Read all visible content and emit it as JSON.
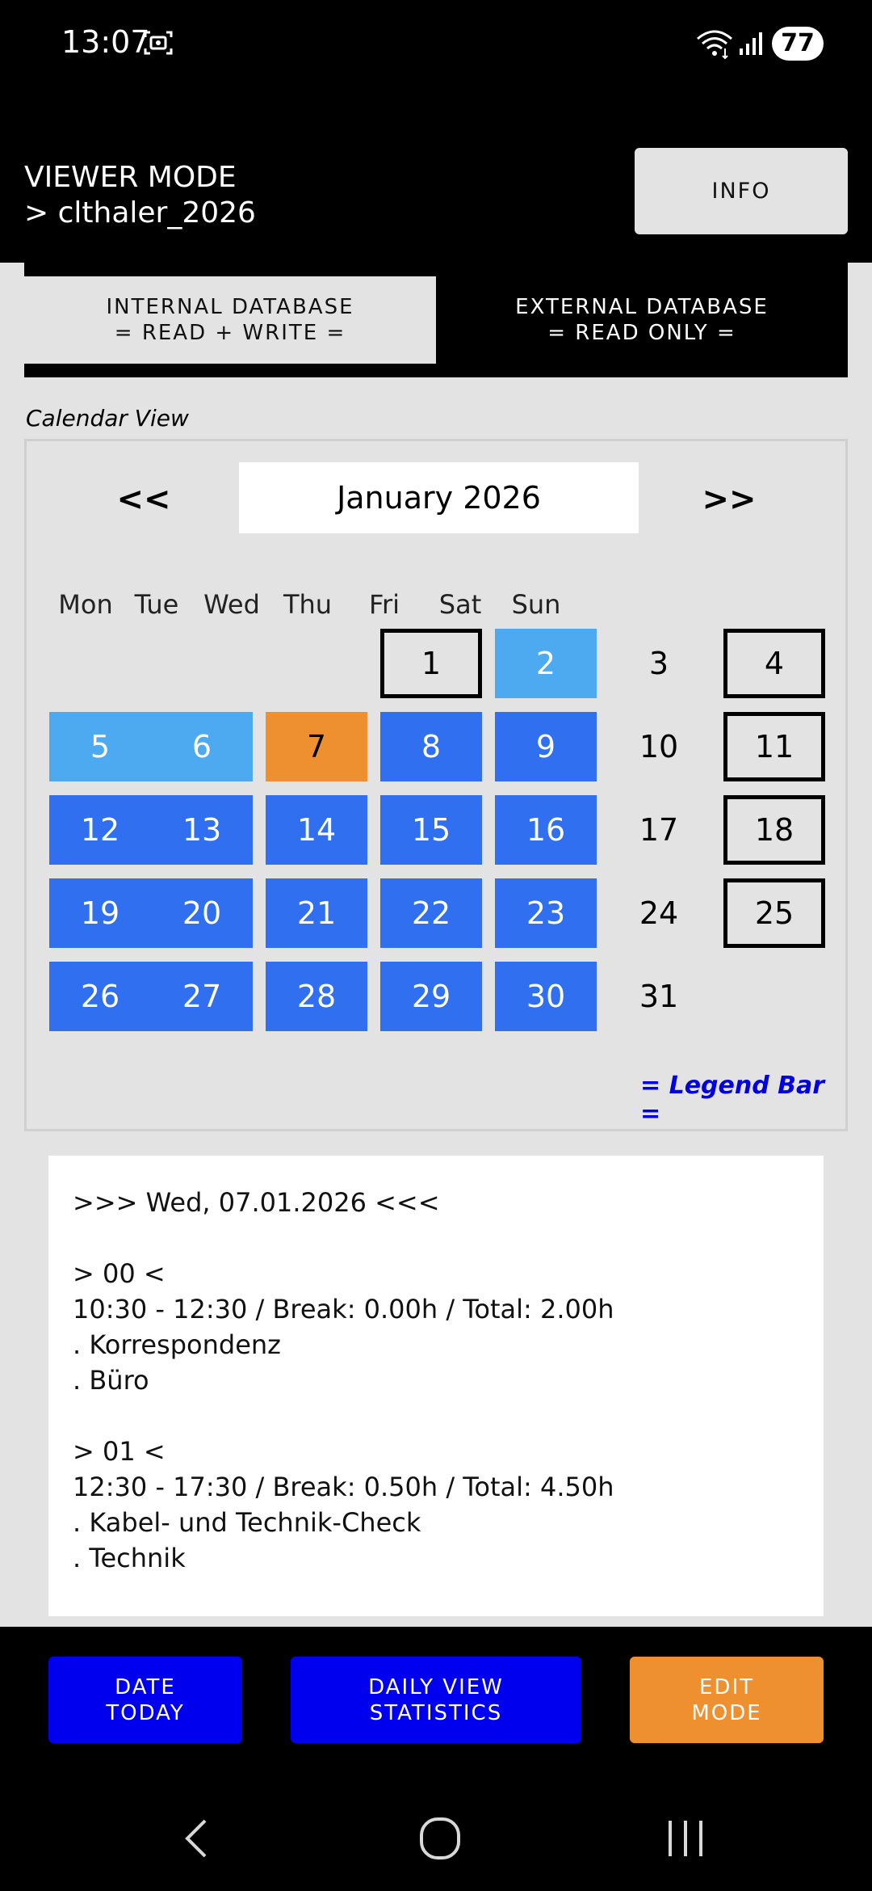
{
  "status_bar": {
    "time": "13:07",
    "battery": "77"
  },
  "header": {
    "mode_line1": "VIEWER MODE",
    "mode_line2": "> clthaler_2026",
    "info_label": "INFO"
  },
  "db_tabs": {
    "internal_line1": "INTERNAL DATABASE",
    "internal_line2": "= READ + WRITE =",
    "external_line1": "EXTERNAL DATABASE",
    "external_line2": "= READ ONLY ="
  },
  "calendar": {
    "label": "Calendar View",
    "prev": "<<",
    "next": ">>",
    "month": "January 2026",
    "weekdays": [
      "Mon",
      "Tue",
      "Wed",
      "Thu",
      "Fri",
      "Sat",
      "Sun"
    ],
    "legend_link": "= Legend Bar =",
    "days": [
      {
        "n": "1",
        "style": "outlined"
      },
      {
        "n": "2",
        "style": "lightblue"
      },
      {
        "n": "3",
        "style": "plain"
      },
      {
        "n": "4",
        "style": "outlined"
      },
      {
        "n": "5",
        "style": "lightblue"
      },
      {
        "n": "6",
        "style": "lightblue"
      },
      {
        "n": "7",
        "style": "orange"
      },
      {
        "n": "8",
        "style": "blue"
      },
      {
        "n": "9",
        "style": "blue"
      },
      {
        "n": "10",
        "style": "plain"
      },
      {
        "n": "11",
        "style": "outlined"
      },
      {
        "n": "12",
        "style": "blue"
      },
      {
        "n": "13",
        "style": "blue"
      },
      {
        "n": "14",
        "style": "blue"
      },
      {
        "n": "15",
        "style": "blue"
      },
      {
        "n": "16",
        "style": "blue"
      },
      {
        "n": "17",
        "style": "plain"
      },
      {
        "n": "18",
        "style": "outlined"
      },
      {
        "n": "19",
        "style": "blue"
      },
      {
        "n": "20",
        "style": "blue"
      },
      {
        "n": "21",
        "style": "blue"
      },
      {
        "n": "22",
        "style": "blue"
      },
      {
        "n": "23",
        "style": "blue"
      },
      {
        "n": "24",
        "style": "plain"
      },
      {
        "n": "25",
        "style": "outlined"
      },
      {
        "n": "26",
        "style": "blue"
      },
      {
        "n": "27",
        "style": "blue"
      },
      {
        "n": "28",
        "style": "blue"
      },
      {
        "n": "29",
        "style": "blue"
      },
      {
        "n": "30",
        "style": "blue"
      },
      {
        "n": "31",
        "style": "plain"
      }
    ]
  },
  "detail": {
    "lines": [
      ">>> Wed, 07.01.2026 <<<",
      "",
      "> 00 <",
      "10:30 - 12:30 / Break: 0.00h / Total: 2.00h",
      ". Korrespondenz",
      ". Büro",
      "",
      "> 01 <",
      "12:30 - 17:30 / Break: 0.50h / Total: 4.50h",
      ". Kabel- und Technik-Check",
      ". Technik"
    ]
  },
  "bottom_buttons": {
    "date_line1": "DATE",
    "date_line2": "TODAY",
    "daily_line1": "DAILY VIEW",
    "daily_line2": "STATISTICS",
    "edit_line1": "EDIT",
    "edit_line2": "MODE"
  },
  "colors": {
    "blue": "#2f6ff0",
    "lightblue": "#4eaaf0",
    "orange": "#ef9030",
    "button_blue": "#0000ee",
    "legend": "#0000e0"
  },
  "icons": {
    "status": [
      "screenshot-icon",
      "wifi-icon",
      "signal-icon"
    ],
    "nav": [
      "back-icon",
      "home-icon",
      "recents-icon"
    ]
  }
}
